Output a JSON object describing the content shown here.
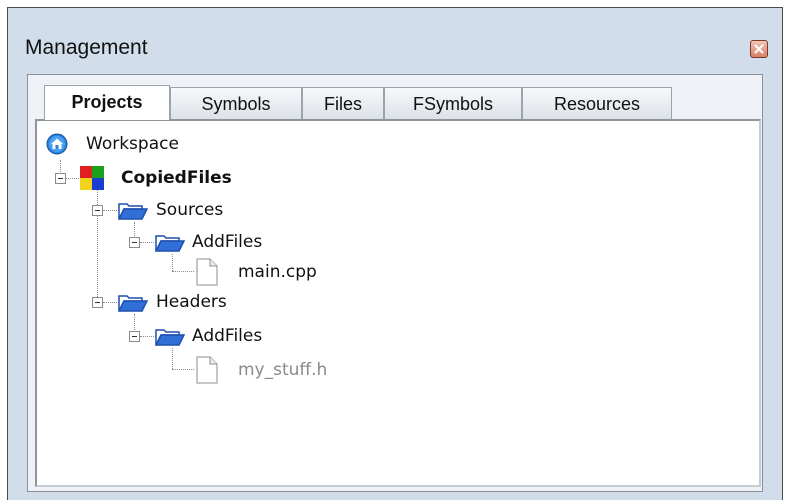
{
  "window": {
    "title": "Management"
  },
  "tabs": [
    {
      "label": "Projects",
      "active": true
    },
    {
      "label": "Symbols",
      "active": false
    },
    {
      "label": "Files",
      "active": false
    },
    {
      "label": "FSymbols",
      "active": false
    },
    {
      "label": "Resources",
      "active": false
    }
  ],
  "tree": {
    "workspace": "Workspace",
    "project": "CopiedFiles",
    "sources": "Sources",
    "sources_addfiles": "AddFiles",
    "main_file": "main.cpp",
    "headers": "Headers",
    "headers_addfiles": "AddFiles",
    "header_file": "my_stuff.h"
  },
  "colors": {
    "folder_blue": "#2f6fd6",
    "workspace_blue": "#2a7fe0",
    "disabled_text": "#8a8a8a"
  }
}
